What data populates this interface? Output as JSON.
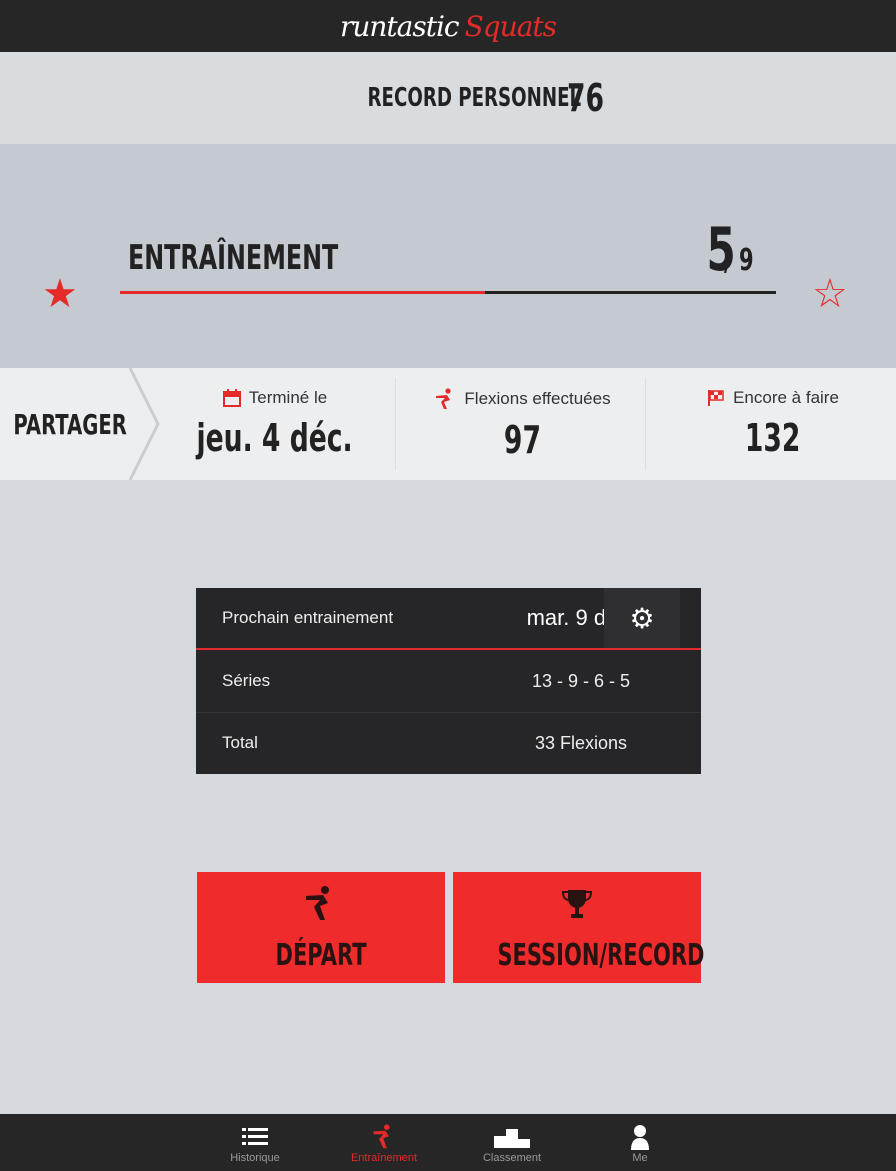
{
  "app": {
    "logo_main": "runtastic",
    "logo_sub": "Squats"
  },
  "record": {
    "label": "RECORD PERSONNEL",
    "value": "76"
  },
  "training": {
    "title": "ENTRAÎNEMENT",
    "current": "5",
    "total": "/ 9",
    "progress_fraction": 0.556
  },
  "share": {
    "label": "PARTAGER"
  },
  "stats": [
    {
      "label": "Terminé le",
      "value": "jeu. 4 déc.",
      "icon": "calendar-icon"
    },
    {
      "label": "Flexions effectuées",
      "value": "97",
      "icon": "squat-icon"
    },
    {
      "label": "Encore à faire",
      "value": "132",
      "icon": "checkered-flag-icon"
    }
  ],
  "next": {
    "label": "Prochain entrainement",
    "date": "mar. 9 déc.",
    "series_label": "Séries",
    "series_value": "13 - 9 - 6 - 5",
    "total_label": "Total",
    "total_value": "33 Flexions"
  },
  "buttons": {
    "start": "DÉPART",
    "session": "SESSION/RECORD"
  },
  "tabs": [
    {
      "label": "Historique",
      "icon": "list-icon",
      "active": false
    },
    {
      "label": "Entraînement",
      "icon": "squat-icon",
      "active": true
    },
    {
      "label": "Classement",
      "icon": "podium-icon",
      "active": false
    },
    {
      "label": "Me",
      "icon": "user-icon",
      "active": false
    }
  ],
  "colors": {
    "accent": "#e52a2a",
    "dark": "#262626",
    "panel": "#262628",
    "button": "#ef2b2b"
  }
}
